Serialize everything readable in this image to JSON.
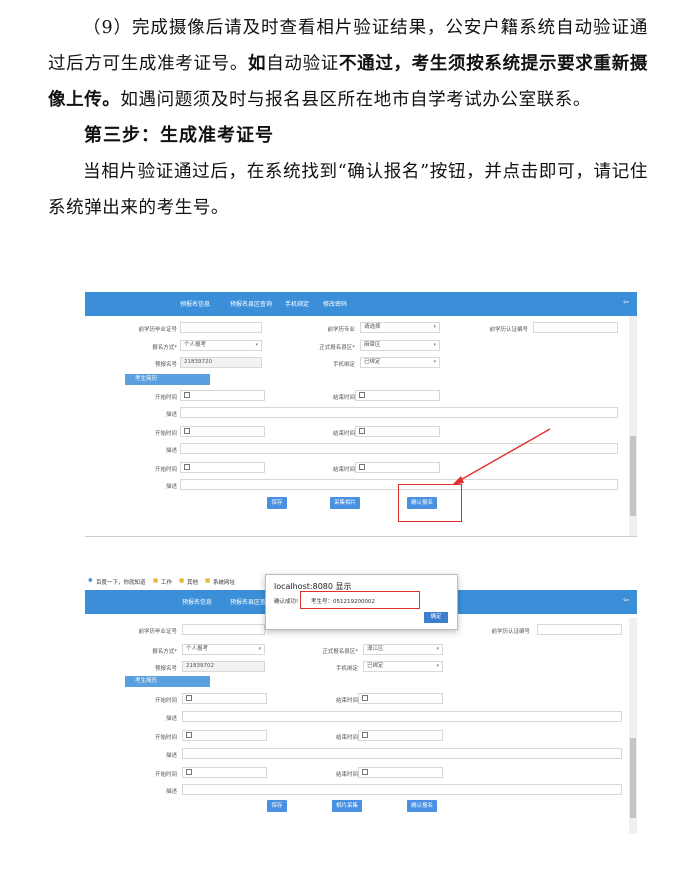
{
  "doc": {
    "para1_a": "（9）完成摄像后请及时查看相片验证结果，公安户籍系统自动验证通过后方可生成准考证号。",
    "para1_b1": "如",
    "para1_c": "自动验证",
    "para1_d": "不通过，考生须按系统提示要求重新摄像上传。",
    "para1_e": "如遇问题须及时与报名县区所在地市自学考试办公室联系。",
    "step3_title": "第三步：生成准考证号",
    "para2": "当相片验证通过后，在系统找到“确认报名”按钮，并点击即可，请记住系统弹出来的考生号。"
  },
  "shot1": {
    "nav": [
      "预报名信息",
      "预报名县区查询",
      "手机绑定",
      "修改密码"
    ],
    "nav_right": "⇦",
    "fields": {
      "prev_cert_label": "前学历毕业证号",
      "major_label": "前学历专业",
      "major_value": "请选择",
      "prev_auth_label": "前学历认证编号",
      "apply_method_label": "报名方式*",
      "apply_method_value": "个人报考",
      "region_label": "正式报名县区*",
      "region_value": "麻章区",
      "pre_no_label": "预报名号",
      "pre_no_value": "21839720",
      "phone_label": "手机绑定",
      "phone_value": "已绑定"
    },
    "section": "考生简历",
    "resume": {
      "start": "开始时间",
      "end": "结束时间",
      "desc": "描述"
    },
    "buttons": {
      "save": "保存",
      "photo": "采集相片",
      "confirm": "确认报名"
    }
  },
  "shot2": {
    "bookmarks": [
      "百度一下，你就知道",
      "工作",
      "其他",
      "系统网址"
    ],
    "nav": [
      "预报名信息",
      "预报名县区查"
    ],
    "nav_right": "⇦",
    "dialog": {
      "title": "localhost:8080 显示",
      "msg": "确认成功!",
      "num": "考生号：051219200002",
      "ok": "确定"
    },
    "fields": {
      "prev_cert_label": "前学历毕业证号",
      "prev_auth_label": "前学历认证编号",
      "apply_method_label": "报名方式*",
      "apply_method_value": "个人报考",
      "region_label": "正式报名县区*",
      "region_value": "濠江区",
      "pre_no_label": "预报名号",
      "pre_no_value": "21839702",
      "phone_label": "手机绑定",
      "phone_value": "已绑定"
    },
    "section": "考生简历",
    "resume": {
      "start": "开始时间",
      "end": "结束时间",
      "desc": "描述"
    },
    "buttons": {
      "save": "保存",
      "photo": "相片采集",
      "confirm": "确认报名"
    }
  }
}
